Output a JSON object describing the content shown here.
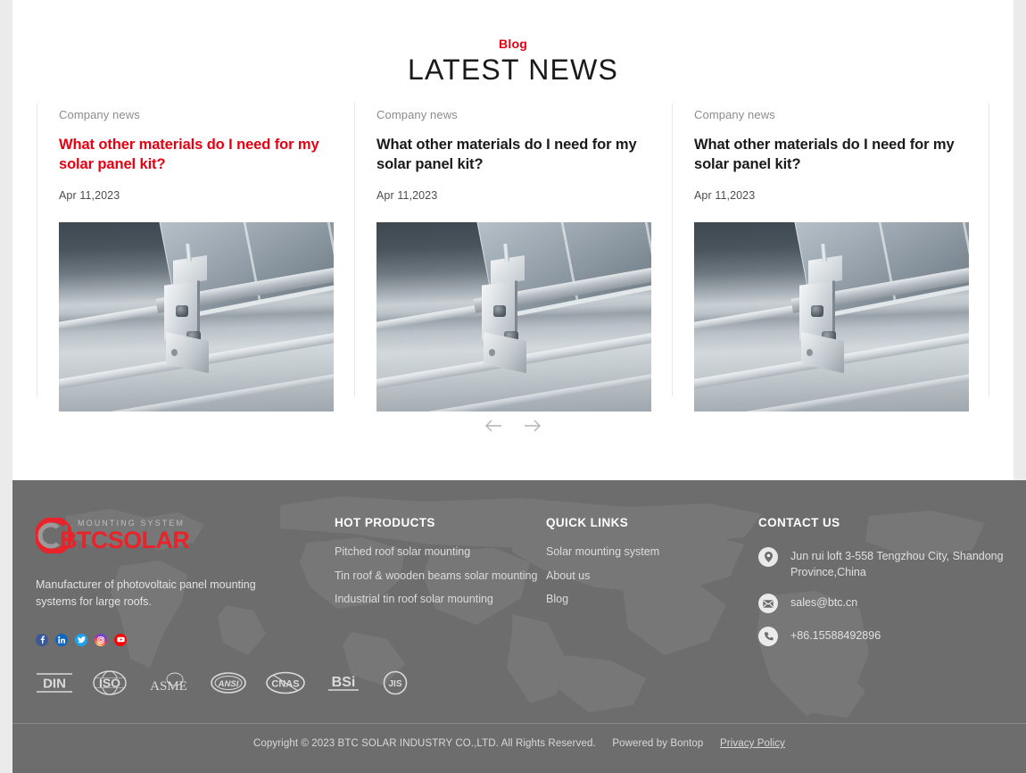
{
  "news": {
    "eyebrow": "Blog",
    "title": "LATEST NEWS",
    "cards": [
      {
        "category": "Company news",
        "title": "What other materials do I need for my solar panel kit?",
        "date": "Apr 11,2023",
        "image_alt": "solar-panel-roof-mounting-clamp",
        "state": "active"
      },
      {
        "category": "Company news",
        "title": "What other materials do I need for my solar panel kit?",
        "date": "Apr 11,2023",
        "image_alt": "solar-panel-roof-mounting-clamp",
        "state": "default"
      },
      {
        "category": "Company news",
        "title": "What other materials do I need for my solar panel kit?",
        "date": "Apr 11,2023",
        "image_alt": "solar-panel-roof-mounting-clamp",
        "state": "default"
      }
    ],
    "nav": {
      "prev_icon": "arrow-left-icon",
      "prev_glyph": "←",
      "next_icon": "arrow-right-icon",
      "next_glyph": "→"
    }
  },
  "footer": {
    "logo": {
      "mark": "btcsolar-logo-mark",
      "tagline": "MOUNTING SYSTEM",
      "name": "BTCSOLAR"
    },
    "description": "Manufacturer of photovoltaic panel mounting systems for large roofs.",
    "socials": [
      {
        "name": "facebook-icon",
        "glyph": "f"
      },
      {
        "name": "linkedin-icon",
        "glyph": "in"
      },
      {
        "name": "twitter-icon",
        "glyph": "t"
      },
      {
        "name": "instagram-icon",
        "glyph": "◉"
      },
      {
        "name": "youtube-icon",
        "glyph": "▶"
      }
    ],
    "hot_products": {
      "heading": "HOT PRODUCTS",
      "links": [
        "Pitched roof solar mounting",
        "Tin roof & wooden beams solar mounting",
        "Industrial tin roof solar mounting"
      ]
    },
    "quick_links": {
      "heading": "QUICK LINKS",
      "links": [
        "Solar mounting system",
        "About us",
        "Blog"
      ]
    },
    "contact": {
      "heading": "CONTACT US",
      "items": [
        {
          "icon": "location-pin-icon",
          "text": "Jun rui loft 3-558 Tengzhou City, Shandong Province,China"
        },
        {
          "icon": "envelope-icon",
          "text": "sales@btc.cn"
        },
        {
          "icon": "phone-icon",
          "text": "+86.15588492896"
        }
      ]
    },
    "certifications": [
      "DIN",
      "ISO",
      "ASME",
      "ANSI",
      "CNAS",
      "BSi",
      "JIS"
    ],
    "copyright": {
      "text": "Copyright © 2023 BTC SOLAR INDUSTRY CO.,LTD. All Rights Reserved.",
      "powered_by": "Powered by Bontop",
      "privacy": "Privacy Policy"
    }
  },
  "colors": {
    "brand_red": "#e60012",
    "logo_red": "#e8232a",
    "footer_bg": "#6d6d6d",
    "page_bg": "#ebebeb",
    "text_dark": "#1a1a1a",
    "text_muted": "#8c8c8c"
  }
}
